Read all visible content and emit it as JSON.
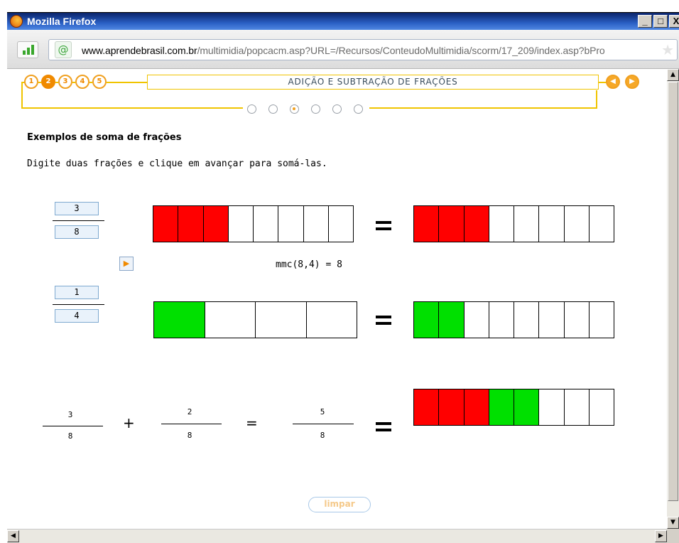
{
  "window": {
    "title": "Mozilla Firefox",
    "min_label": "_",
    "max_label": "□",
    "close_label": "X"
  },
  "addressbar": {
    "url_domain": "www.aprendebrasil.com.br",
    "url_path": "/multimidia/popcacm.asp?URL=/Recursos/ConteudoMultimidia/scorm/17_209/index.asp?bPro",
    "site_icon": "@"
  },
  "lesson": {
    "title": "ADIÇÃO E SUBTRAÇÃO DE FRAÇÕES",
    "steps": [
      "1",
      "2",
      "3",
      "4",
      "5"
    ],
    "active_step": 2,
    "progress_dots": 6,
    "active_dot": 3,
    "accent_color": "#f0a020"
  },
  "content": {
    "heading": "Exemplos de soma de frações",
    "instruction": "Digite duas frações e clique em avançar para somá-las.",
    "fraction1": {
      "numerator": "3",
      "denominator": "8",
      "total_parts": 8,
      "filled": 3,
      "color": "red"
    },
    "fraction2": {
      "numerator": "1",
      "denominator": "4",
      "total_parts": 4,
      "filled": 1,
      "color": "green"
    },
    "fraction2_converted": {
      "total_parts": 8,
      "filled": 2
    },
    "mmc_text": "mmc(8,4) = 8",
    "equation": {
      "a_num": "3",
      "a_den": "8",
      "plus": "+",
      "b_num": "2",
      "b_den": "8",
      "equals": "=",
      "r_num": "5",
      "r_den": "8"
    },
    "result_bar": {
      "total_parts": 8,
      "red": 3,
      "green": 2
    },
    "clear_label": "limpar"
  }
}
